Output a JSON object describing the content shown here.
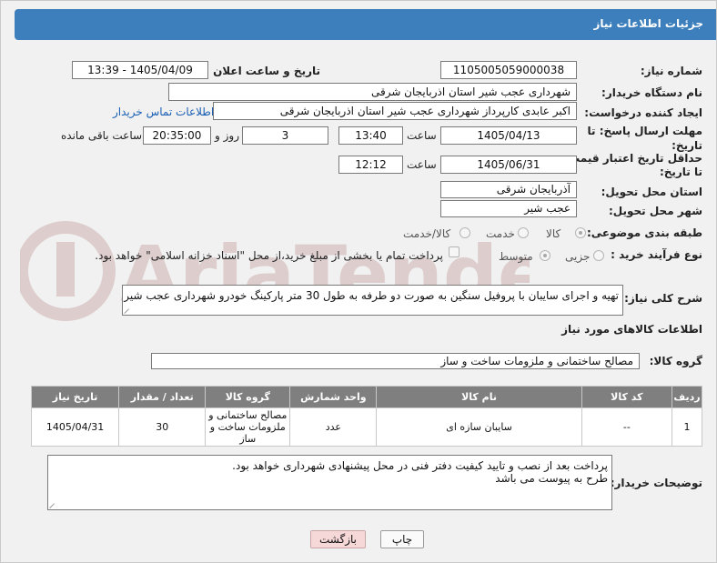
{
  "header": {
    "title": "جزئیات اطلاعات نیاز"
  },
  "fields": {
    "need_number": {
      "label": "شماره نیاز:",
      "value": "1105005059000038"
    },
    "announce_datetime": {
      "label": "تاریخ و ساعت اعلان عمومی:",
      "value": "1405/04/09 - 13:39"
    },
    "buyer_org": {
      "label": "نام دستگاه خریدار:",
      "value": "شهرداری عجب شیر استان اذربایجان شرقی"
    },
    "creator": {
      "label": "ایجاد کننده درخواست:",
      "value": "اکبر عابدی کارپرداز شهرداری عجب شیر استان اذربایجان شرقی",
      "contact_link": "اطلاعات تماس خریدار"
    },
    "deadline": {
      "label_line1": "مهلت ارسال پاسخ: تا",
      "label_line2": "تاریخ:",
      "date": "1405/04/13",
      "time_label": "ساعت",
      "time": "13:40",
      "days": "3",
      "days_label": "روز و",
      "remaining_time": "20:35:00",
      "remaining_label": "ساعت باقی مانده"
    },
    "price_validity": {
      "label_line1": "حداقل تاریخ اعتبار قیمت:",
      "label_line2": "تا تاریخ:",
      "date": "1405/06/31",
      "time_label": "ساعت",
      "time": "12:12"
    },
    "delivery_province": {
      "label": "استان محل تحویل:",
      "value": "آذربایجان شرقی"
    },
    "delivery_city": {
      "label": "شهر محل تحویل:",
      "value": "عجب شیر"
    },
    "category": {
      "label": "طبقه بندی موضوعی:",
      "options": [
        "کالا",
        "خدمت",
        "کالا/خدمت"
      ],
      "selected": "کالا"
    },
    "process_type": {
      "label": "نوع فرآیند خرید :",
      "options": [
        "جزیی",
        "متوسط"
      ],
      "selected": "متوسط",
      "payment_note": "پرداخت تمام یا بخشی از مبلغ خرید،از محل \"اسناد خزانه اسلامی\" خواهد بود."
    },
    "general_desc": {
      "label": "شرح کلی نیاز:",
      "value": "تهیه و اجرای سایبان با پروفیل سنگین به صورت  دو طرفه  به طول 30 متر پارکینگ خودرو شهرداری عجب شیر"
    }
  },
  "items_section": {
    "title": "اطلاعات کالاهای مورد نیاز",
    "group_label": "گروه کالا:",
    "group_value": "مصالح ساختمانی و ملزومات ساخت و ساز",
    "columns": [
      "ردیف",
      "کد کالا",
      "نام کالا",
      "واحد شمارش",
      "گروه کالا",
      "تعداد / مقدار",
      "تاریخ نیاز"
    ],
    "rows": [
      {
        "row": "1",
        "code": "--",
        "name": "سایبان سازه ای",
        "unit": "عدد",
        "group": "مصالح ساختمانی و ملزومات ساخت و ساز",
        "qty": "30",
        "date": "1405/04/31"
      }
    ]
  },
  "buyer_notes": {
    "label": "توضیحات خریدار:",
    "line1": "پرداخت بعد از نصب و تایید کیفیت دفتر فنی در محل پیشنهادی شهرداری خواهد بود.",
    "line2": "طرح به پیوست می باشد"
  },
  "buttons": {
    "print": "چاپ",
    "back": "بازگشت"
  },
  "watermark": {
    "text": "AriaTender.net"
  }
}
